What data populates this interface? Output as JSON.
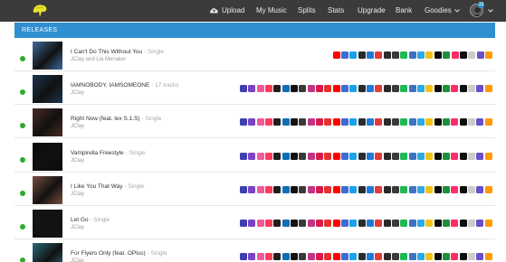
{
  "nav": {
    "upload": "Upload",
    "my_music": "My Music",
    "splits": "Splits",
    "stats": "Stats",
    "upgrade": "Upgrade",
    "bank": "Bank",
    "goodies": "Goodies",
    "avatar_badge": "13"
  },
  "section": {
    "title": "RELEASES"
  },
  "colors": {
    "topbar": "#3b3b3b",
    "header": "#2f8fd0",
    "status_live": "#2fa82f",
    "store_palette": [
      "#3f3fb0",
      "#7b42c8",
      "#f05a9a",
      "#ff3b5c",
      "#1e1e1e",
      "#0e6fb8",
      "#121212",
      "#3a3a3a",
      "#c13584",
      "#d81b4a",
      "#e5322d",
      "#ff0000",
      "#3b6bd6",
      "#1aa3e8",
      "#2b2b2b",
      "#1f7ad6",
      "#e33b3b",
      "#2a2a2a",
      "#3a3a3a",
      "#1db954",
      "#3b73c0",
      "#2fa9e0",
      "#f3c219",
      "#0a0a0a",
      "#1e8f3a",
      "#ff2b6a",
      "#0d0d0d",
      "#cccccc",
      "#6a4fc7",
      "#ff9a00"
    ]
  },
  "releases": [
    {
      "title": "I Can't Do This Without You",
      "separator": " - ",
      "type": "Single",
      "artist": "JClay and Lia Menaker",
      "store_count": 19,
      "art": "#3d6b9a"
    },
    {
      "title": "IAMNOBODY, IAMSOMEONE",
      "separator": " - ",
      "type": "17 tracks",
      "artist": "JClay",
      "store_count": 30,
      "art": "#1a3550"
    },
    {
      "title": "Right Now (feat. lex S.1.S)",
      "separator": " - ",
      "type": "Single",
      "artist": "JClay",
      "store_count": 30,
      "art": "#4a2a20"
    },
    {
      "title": "Vampirella Freestyle",
      "separator": " - ",
      "type": "Single",
      "artist": "JClay",
      "store_count": 30,
      "art": "#0a0a0a"
    },
    {
      "title": "I Like You That Way",
      "separator": " - ",
      "type": "Single",
      "artist": "JClay",
      "store_count": 30,
      "art": "#7a4e3c"
    },
    {
      "title": "Let Go",
      "separator": " - ",
      "type": "Single",
      "artist": "JClay",
      "store_count": 30,
      "art": "#151515"
    },
    {
      "title": "For Flyers Only (feat. OPlus)",
      "separator": " - ",
      "type": "Single",
      "artist": "JClay",
      "store_count": 30,
      "art": "#2a6a7a"
    }
  ]
}
